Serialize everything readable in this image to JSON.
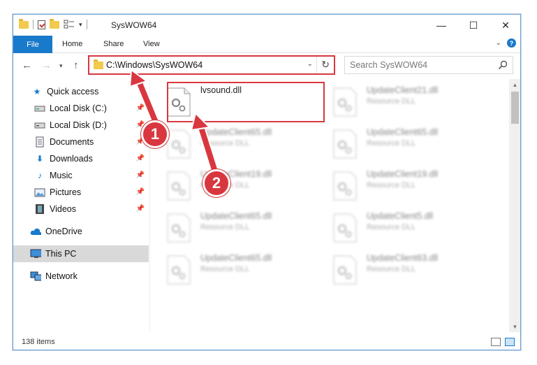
{
  "window": {
    "title": "SysWOW64",
    "minimize_glyph": "—",
    "maximize_glyph": "☐",
    "close_glyph": "✕"
  },
  "ribbon": {
    "tabs": [
      "File",
      "Home",
      "Share",
      "View"
    ],
    "help_glyph": "?"
  },
  "address": {
    "path": "C:\\Windows\\SysWOW64",
    "search_placeholder": "Search SysWOW64"
  },
  "sidebar": {
    "items": [
      {
        "label": "Quick access",
        "icon": "star-icon",
        "pinned": false
      },
      {
        "label": "Local Disk (C:)",
        "icon": "drive-icon",
        "pinned": true
      },
      {
        "label": "Local Disk (D:)",
        "icon": "drive-icon",
        "pinned": true
      },
      {
        "label": "Documents",
        "icon": "documents-icon",
        "pinned": true
      },
      {
        "label": "Downloads",
        "icon": "downloads-icon",
        "pinned": true
      },
      {
        "label": "Music",
        "icon": "music-icon",
        "pinned": true
      },
      {
        "label": "Pictures",
        "icon": "pictures-icon",
        "pinned": true
      },
      {
        "label": "Videos",
        "icon": "videos-icon",
        "pinned": true
      },
      {
        "label": "OneDrive",
        "icon": "onedrive-icon",
        "pinned": false
      },
      {
        "label": "This PC",
        "icon": "this-pc-icon",
        "pinned": false,
        "selected": true
      },
      {
        "label": "Network",
        "icon": "network-icon",
        "pinned": false
      }
    ]
  },
  "files": [
    {
      "name": "lvsound.dll",
      "type": "",
      "highlighted": true
    },
    {
      "name": "UpdateClient21.dll",
      "type": "Resource DLL"
    },
    {
      "name": "UpdateClient65.dll",
      "type": "Resource DLL"
    },
    {
      "name": "UpdateClient65.dll",
      "type": "Resource DLL"
    },
    {
      "name": "UpdateClient19.dll",
      "type": "Resource DLL"
    },
    {
      "name": "UpdateClient19.dll",
      "type": "Resource DLL"
    },
    {
      "name": "UpdateClient65.dll",
      "type": "Resource DLL"
    },
    {
      "name": "UpdateClient5.dll",
      "type": "Resource DLL"
    },
    {
      "name": "UpdateClient65.dll",
      "type": "Resource DLL"
    },
    {
      "name": "UpdateClient63.dll",
      "type": "Resource DLL"
    }
  ],
  "status": {
    "item_count": "138 items"
  },
  "callouts": {
    "one": "1",
    "two": "2",
    "color": "#d9373f"
  },
  "colors": {
    "accent": "#1979ca",
    "highlight": "#d9373f",
    "selected_bg": "#d9d9d9"
  }
}
